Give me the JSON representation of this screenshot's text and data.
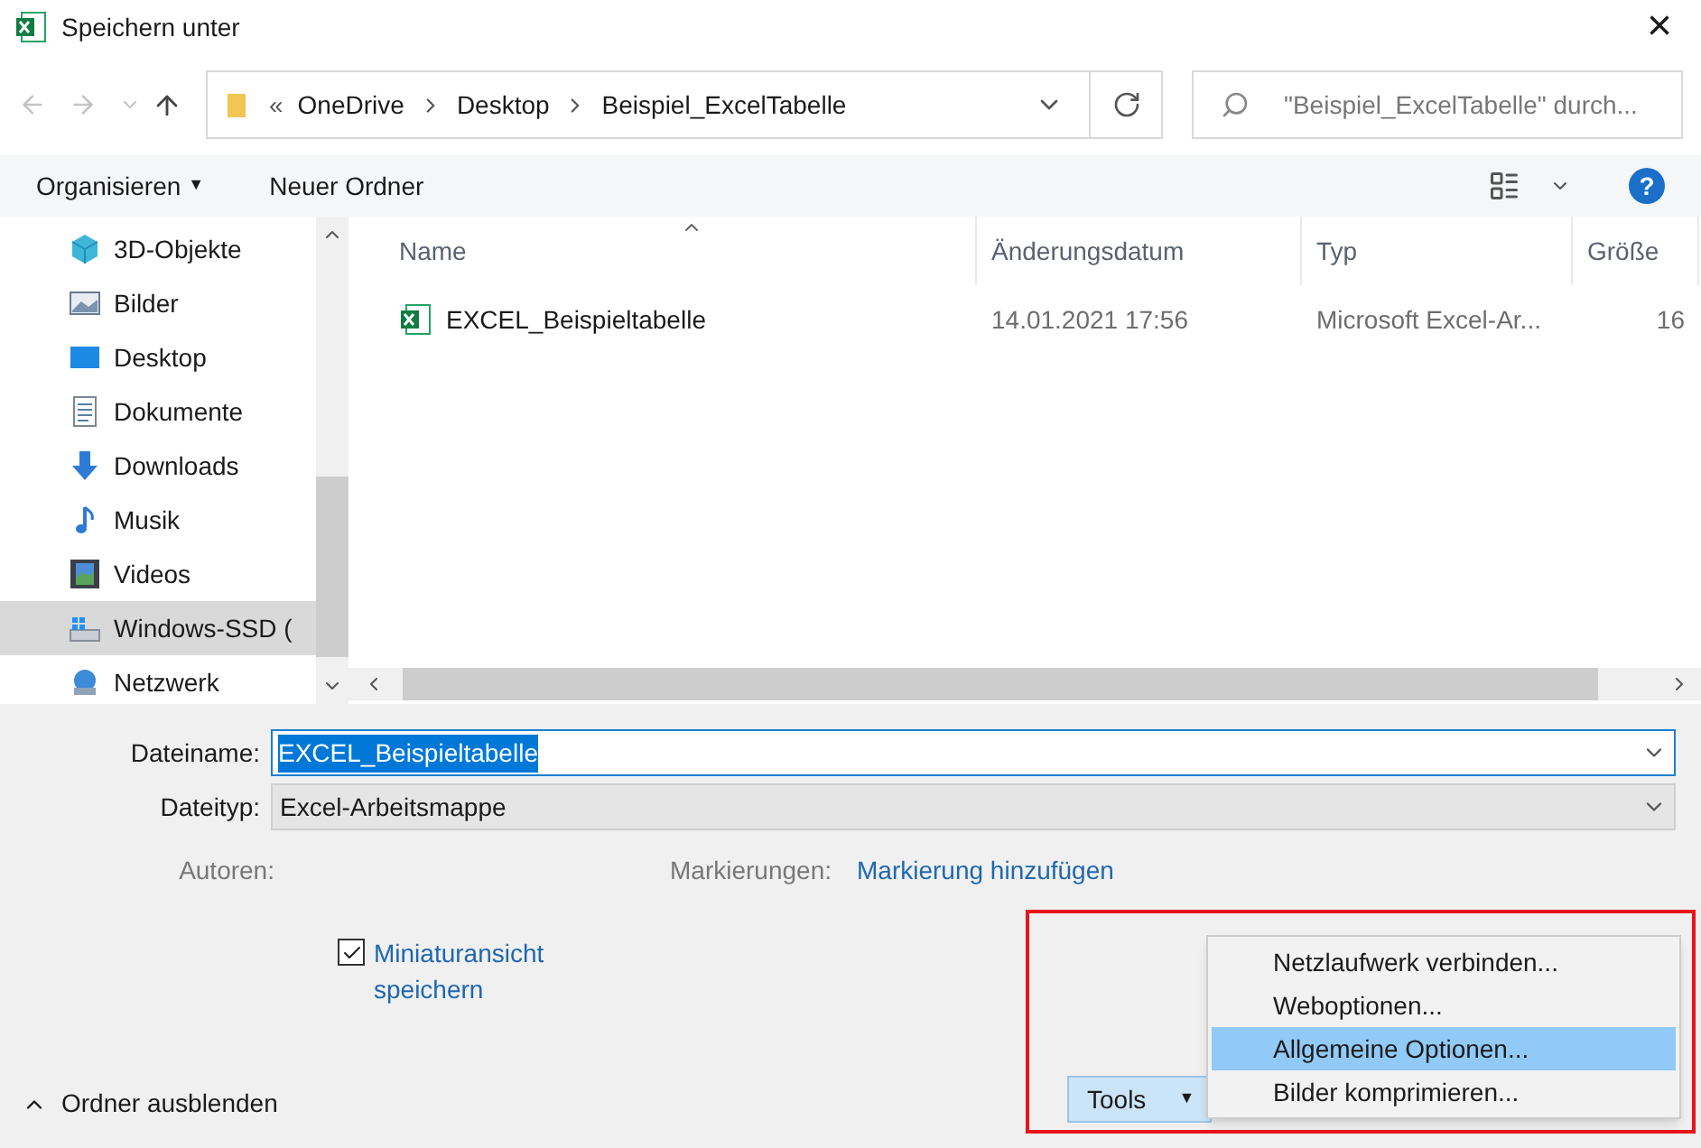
{
  "window": {
    "title": "Speichern unter",
    "close": "×"
  },
  "address": {
    "overflow": "«",
    "crumbs": [
      "OneDrive",
      "Desktop",
      "Beispiel_ExcelTabelle"
    ]
  },
  "search": {
    "placeholder": "\"Beispiel_ExcelTabelle\" durch..."
  },
  "toolbar": {
    "organize": "Organisieren",
    "organize_caret": "▼",
    "new_folder": "Neuer Ordner",
    "help": "?"
  },
  "sidebar": {
    "items": [
      {
        "label": "3D-Objekte",
        "kind": "cube",
        "selected": false
      },
      {
        "label": "Bilder",
        "kind": "pictures",
        "selected": false
      },
      {
        "label": "Desktop",
        "kind": "desktop",
        "selected": false
      },
      {
        "label": "Dokumente",
        "kind": "document",
        "selected": false
      },
      {
        "label": "Downloads",
        "kind": "download",
        "selected": false
      },
      {
        "label": "Musik",
        "kind": "music",
        "selected": false
      },
      {
        "label": "Videos",
        "kind": "video",
        "selected": false
      },
      {
        "label": "Windows-SSD (",
        "kind": "drive",
        "selected": true
      },
      {
        "label": "Netzwerk",
        "kind": "network",
        "selected": false
      }
    ]
  },
  "table": {
    "columns": [
      {
        "label": "Name",
        "sorted": true
      },
      {
        "label": "Änderungsdatum",
        "sorted": false
      },
      {
        "label": "Typ",
        "sorted": false
      },
      {
        "label": "Größe",
        "sorted": false
      }
    ],
    "rows": [
      {
        "name": "EXCEL_Beispieltabelle",
        "date": "14.01.2021 17:56",
        "type": "Microsoft Excel-Ar...",
        "size": "16"
      }
    ]
  },
  "form": {
    "filename_label": "Dateiname:",
    "filename": "EXCEL_Beispieltabelle",
    "filetype_label": "Dateityp:",
    "filetype": "Excel-Arbeitsmappe",
    "authors_label": "Autoren:",
    "tags_label": "Markierungen:",
    "tags_link": "Markierung hinzufügen"
  },
  "thumbnail": {
    "label": "Miniaturansicht speichern",
    "checked": true
  },
  "hide_folders": "Ordner ausblenden",
  "tools": {
    "label": "Tools",
    "caret": "▼",
    "menu": [
      {
        "label": "Netzlaufwerk verbinden...",
        "selected": false
      },
      {
        "label": "Weboptionen...",
        "selected": false
      },
      {
        "label": "Allgemeine Optionen...",
        "selected": true
      },
      {
        "label": "Bilder komprimieren...",
        "selected": false
      }
    ]
  }
}
